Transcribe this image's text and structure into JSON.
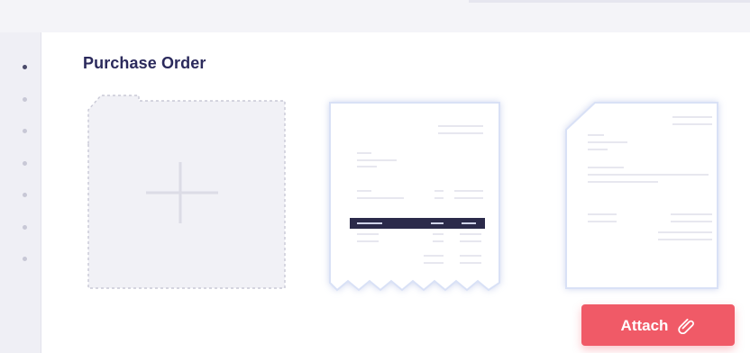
{
  "header": {
    "title": "Purchase Order"
  },
  "actions": {
    "attach_label": "Attach"
  },
  "step_dots": [
    {
      "active": true
    },
    {
      "active": false
    },
    {
      "active": false
    },
    {
      "active": false
    },
    {
      "active": false
    },
    {
      "active": false
    },
    {
      "active": false
    }
  ],
  "icons": {
    "add": "plus-icon",
    "receipt": "receipt-icon",
    "document": "document-icon",
    "attach": "paperclip-icon"
  },
  "colors": {
    "title": "#2b2a5c",
    "accent_button": "#f05a67",
    "dark_bar": "#2b2a4a",
    "placeholder_border": "#c9c9d6"
  }
}
